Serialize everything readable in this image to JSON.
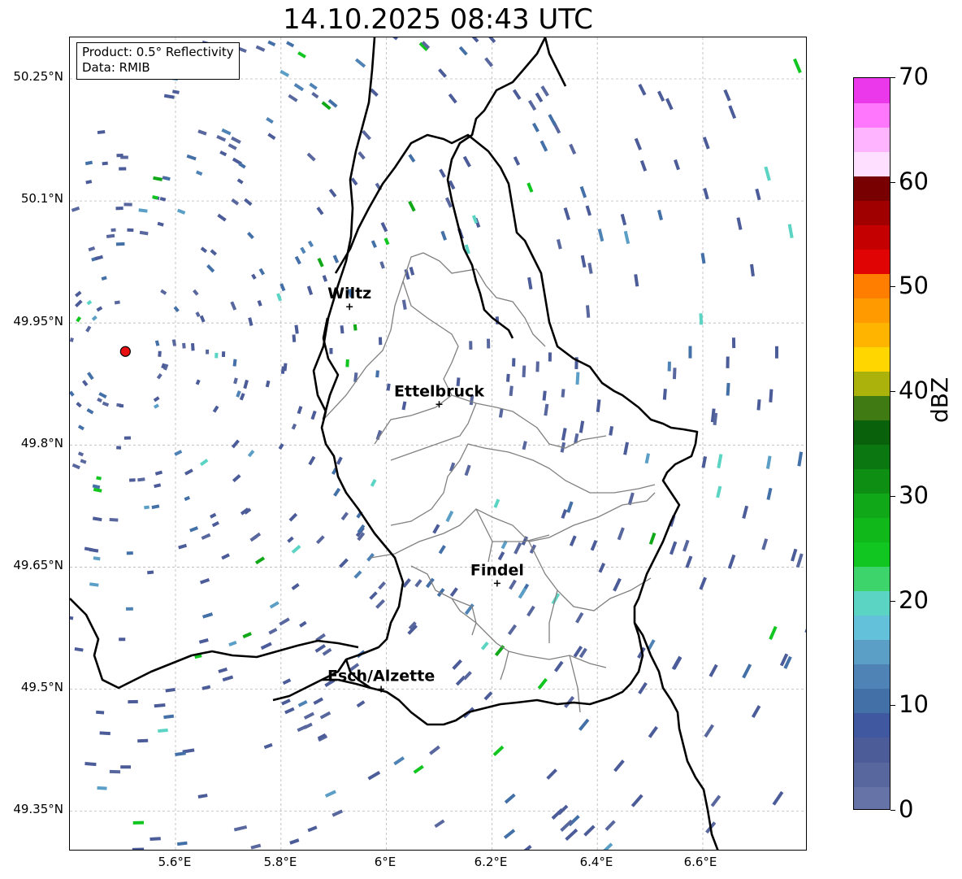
{
  "title": "14.10.2025 08:43 UTC",
  "info": {
    "product": "Product: 0.5° Reflectivity",
    "data": "Data: RMIB"
  },
  "axes": {
    "lat_ticks": [
      "50.25°N",
      "50.1°N",
      "49.95°N",
      "49.8°N",
      "49.65°N",
      "49.5°N",
      "49.35°N"
    ],
    "lon_ticks": [
      "5.6°E",
      "5.8°E",
      "6°E",
      "6.2°E",
      "6.4°E",
      "6.6°E"
    ]
  },
  "cities": [
    {
      "name": "Wiltz",
      "lon": 5.93,
      "lat": 49.97
    },
    {
      "name": "Ettelbruck",
      "lon": 6.1,
      "lat": 49.85
    },
    {
      "name": "Findel",
      "lon": 6.21,
      "lat": 49.63
    },
    {
      "name": "Esch/Alzette",
      "lon": 5.99,
      "lat": 49.5
    }
  ],
  "radar_site": {
    "lon": 5.505,
    "lat": 49.915,
    "color": "#e81010"
  },
  "colorbar": {
    "unit": "dBZ",
    "min": 0,
    "max": 70,
    "tick_labels": [
      "0",
      "10",
      "20",
      "30",
      "40",
      "50",
      "60",
      "70"
    ],
    "colors": [
      "#6573a7",
      "#59679f",
      "#4b5c99",
      "#3f58a0",
      "#4470a8",
      "#4f83b5",
      "#5b9fc7",
      "#63c1da",
      "#5bd4c4",
      "#3dd46c",
      "#12c621",
      "#10b81a",
      "#10a818",
      "#0e8f14",
      "#0b7710",
      "#0a610c",
      "#3f7a12",
      "#acb20c",
      "#ffd600",
      "#ffb500",
      "#ff9a00",
      "#ff7e00",
      "#e00404",
      "#c40000",
      "#a00000",
      "#780000",
      "#ffdfff",
      "#ffb4ff",
      "#ff77fd",
      "#eb38eb"
    ]
  },
  "colors": {
    "country_border": "#000000",
    "canton_border": "#808080",
    "gridline": "#b8b8b8"
  }
}
